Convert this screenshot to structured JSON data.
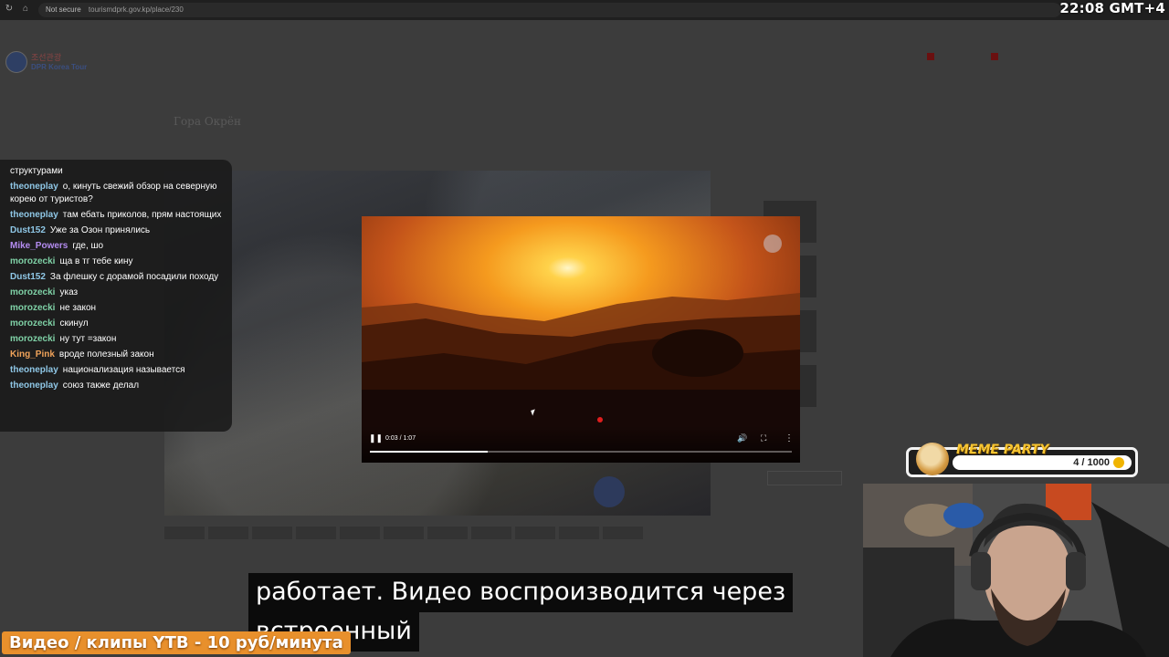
{
  "clock": "22:08 GMT+4",
  "browser": {
    "not_secure": "Not secure",
    "url": "tourismdprk.gov.kp/place/230"
  },
  "site": {
    "logo_korean": "조선관광",
    "logo_sub": "DPR Korea Tour",
    "page_title": "Гора Окрён"
  },
  "chat": [
    {
      "user": "",
      "color": "#ffffff",
      "text": "структурами"
    },
    {
      "user": "theoneplay",
      "color": "#8fc7e6",
      "text": "о, кинуть свежий обзор на северную корею от туристов?"
    },
    {
      "user": "theoneplay",
      "color": "#8fc7e6",
      "text": "там ебать приколов, прям настоящих"
    },
    {
      "user": "Dust152",
      "color": "#8fc7e6",
      "text": "Уже за Озон принялись"
    },
    {
      "user": "Mike_Powers",
      "color": "#b48cf0",
      "text": "где, шо"
    },
    {
      "user": "morozecki",
      "color": "#7fd1a6",
      "text": "ща в тг тебе кину"
    },
    {
      "user": "Dust152",
      "color": "#8fc7e6",
      "text": "За флешку с дорамой посадили походу"
    },
    {
      "user": "morozecki",
      "color": "#7fd1a6",
      "text": "указ"
    },
    {
      "user": "morozecki",
      "color": "#7fd1a6",
      "text": "не закон"
    },
    {
      "user": "morozecki",
      "color": "#7fd1a6",
      "text": "скинул"
    },
    {
      "user": "morozecki",
      "color": "#7fd1a6",
      "text": "ну тут =закон"
    },
    {
      "user": "King_Pink",
      "color": "#f0a35a",
      "text": "вроде полезный закон"
    },
    {
      "user": "theoneplay",
      "color": "#8fc7e6",
      "text": "национализация называется"
    },
    {
      "user": "theoneplay",
      "color": "#8fc7e6",
      "text": "союз также делал"
    }
  ],
  "player": {
    "time": "0:03 / 1:07",
    "progress": 0.28
  },
  "subtitle": {
    "line1": "работает. Видео воспроизводится через",
    "line2": "встроенный"
  },
  "promo": "Видео / клипы YTB - 10 руб/минута",
  "meme": {
    "title": "MEME PARTY",
    "count": "4 / 1000"
  }
}
